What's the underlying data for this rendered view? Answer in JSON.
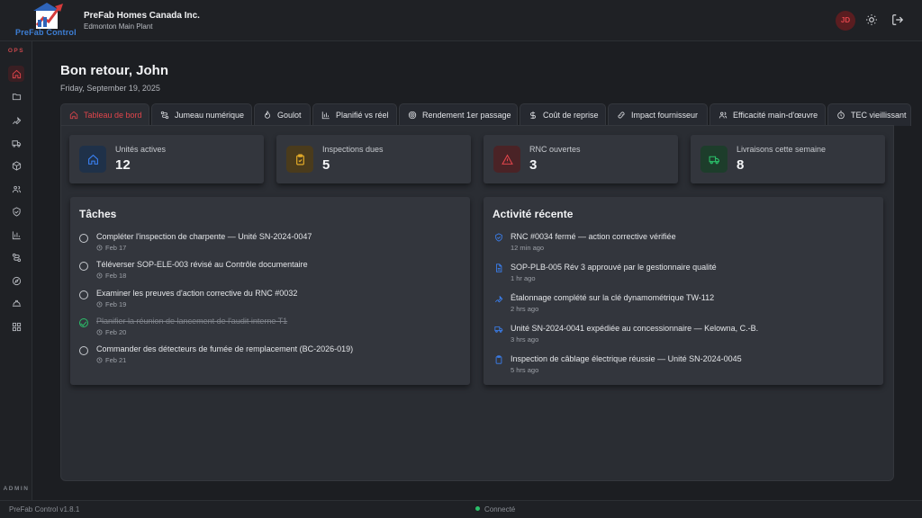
{
  "header": {
    "logo_text": "PreFab Control",
    "company": "PreFab Homes Canada Inc.",
    "plant": "Edmonton Main Plant",
    "avatar_initials": "JD",
    "icons": [
      "sun-icon",
      "logout-icon"
    ]
  },
  "sidebar": {
    "section_top": "OPS",
    "section_bottom": "ADMIN",
    "items": [
      "home",
      "folder",
      "wrench",
      "truck",
      "box",
      "users",
      "shield",
      "chart",
      "route",
      "compass",
      "hard-hat",
      "grid"
    ]
  },
  "welcome": {
    "title": "Bon retour, John",
    "date": "Friday, September 19, 2025"
  },
  "tabs": [
    {
      "label": "Tableau de bord",
      "icon": "home-icon"
    },
    {
      "label": "Jumeau numérique",
      "icon": "route-icon"
    },
    {
      "label": "Goulot",
      "icon": "flame-icon"
    },
    {
      "label": "Planifié vs réel",
      "icon": "chart-icon"
    },
    {
      "label": "Rendement 1er passage",
      "icon": "target-icon"
    },
    {
      "label": "Coût de reprise",
      "icon": "dollar-icon"
    },
    {
      "label": "Impact fournisseur",
      "icon": "link-icon"
    },
    {
      "label": "Efficacité main-d'œuvre",
      "icon": "users-icon"
    },
    {
      "label": "TEC vieillissant",
      "icon": "timer-icon"
    }
  ],
  "stats": [
    {
      "label": "Unités actives",
      "value": "12",
      "color": "#3b82f6"
    },
    {
      "label": "Inspections dues",
      "value": "5",
      "color": "#f0b429"
    },
    {
      "label": "RNC ouvertes",
      "value": "3",
      "color": "#e0454b"
    },
    {
      "label": "Livraisons cette semaine",
      "value": "8",
      "color": "#2bc06a"
    }
  ],
  "tasks": {
    "title": "Tâches",
    "items": [
      {
        "text": "Compléter l'inspection de charpente — Unité SN-2024-0047",
        "date": "Feb 17",
        "done": false
      },
      {
        "text": "Téléverser SOP-ELE-003 révisé au Contrôle documentaire",
        "date": "Feb 18",
        "done": false
      },
      {
        "text": "Examiner les preuves d'action corrective du RNC #0032",
        "date": "Feb 19",
        "done": false
      },
      {
        "text": "Planifier la réunion de lancement de l'audit interne T1",
        "date": "Feb 20",
        "done": true
      },
      {
        "text": "Commander des détecteurs de fumée de remplacement (BC-2026-019)",
        "date": "Feb 21",
        "done": false
      }
    ]
  },
  "activity": {
    "title": "Activité récente",
    "items": [
      {
        "text": "RNC #0034 fermé — action corrective vérifiée",
        "time": "12 min ago",
        "icon": "shield-icon"
      },
      {
        "text": "SOP-PLB-005 Rév 3 approuvé par le gestionnaire qualité",
        "time": "1 hr ago",
        "icon": "document-icon"
      },
      {
        "text": "Étalonnage complété sur la clé dynamométrique TW-112",
        "time": "2 hrs ago",
        "icon": "wrench-icon"
      },
      {
        "text": "Unité SN-2024-0041 expédiée au concessionnaire — Kelowna, C.-B.",
        "time": "3 hrs ago",
        "icon": "truck-icon"
      },
      {
        "text": "Inspection de câblage électrique réussie — Unité SN-2024-0045",
        "time": "5 hrs ago",
        "icon": "clipboard-icon"
      }
    ]
  },
  "footer": {
    "version": "PreFab Control v1.8.1",
    "status": "Connecté"
  },
  "colors": {
    "accent": "#e0454b",
    "background": "#1c1e22",
    "surface": "#33363d",
    "success": "#2bc06a"
  }
}
